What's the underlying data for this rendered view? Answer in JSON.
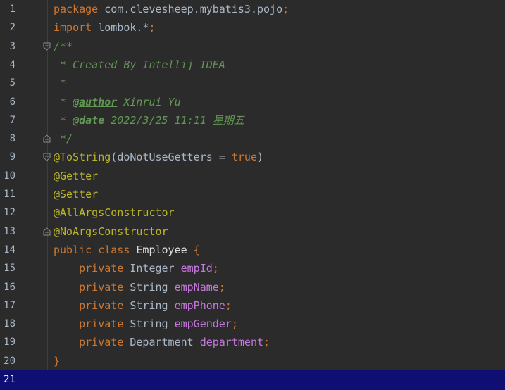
{
  "editor": {
    "current_line": 21,
    "lines": [
      {
        "n": "1",
        "tokens": [
          [
            "kw",
            "package"
          ],
          [
            "plain",
            " com.clevesheep.mybatis3.pojo"
          ],
          [
            "punct",
            ";"
          ]
        ]
      },
      {
        "n": "2",
        "tokens": [
          [
            "kw",
            "import"
          ],
          [
            "plain",
            " lombok.*"
          ],
          [
            "punct",
            ";"
          ]
        ]
      },
      {
        "n": "3",
        "tokens": [
          [
            "doc",
            "/**"
          ]
        ],
        "fold": "open"
      },
      {
        "n": "4",
        "tokens": [
          [
            "doc",
            " * Created By Intellij IDEA"
          ]
        ]
      },
      {
        "n": "5",
        "tokens": [
          [
            "doc",
            " *"
          ]
        ]
      },
      {
        "n": "6",
        "tokens": [
          [
            "doc",
            " * "
          ],
          [
            "doctag",
            "@author"
          ],
          [
            "doc",
            " Xinrui Yu"
          ]
        ]
      },
      {
        "n": "7",
        "tokens": [
          [
            "doc",
            " * "
          ],
          [
            "doctag",
            "@date"
          ],
          [
            "doc",
            " 2022/3/25 11:11 星期五"
          ]
        ]
      },
      {
        "n": "8",
        "tokens": [
          [
            "doc",
            " */"
          ]
        ],
        "fold": "close"
      },
      {
        "n": "9",
        "tokens": [
          [
            "ann",
            "@ToString"
          ],
          [
            "paren",
            "("
          ],
          [
            "plain",
            "doNotUseGetters = "
          ],
          [
            "kw",
            "true"
          ],
          [
            "paren",
            ")"
          ]
        ],
        "fold": "open"
      },
      {
        "n": "10",
        "tokens": [
          [
            "ann",
            "@Getter"
          ]
        ]
      },
      {
        "n": "11",
        "tokens": [
          [
            "ann",
            "@Setter"
          ]
        ]
      },
      {
        "n": "12",
        "tokens": [
          [
            "ann",
            "@AllArgsConstructor"
          ]
        ]
      },
      {
        "n": "13",
        "tokens": [
          [
            "ann",
            "@NoArgsConstructor"
          ]
        ],
        "fold": "close"
      },
      {
        "n": "14",
        "tokens": [
          [
            "kw",
            "public class "
          ],
          [
            "cls",
            "Employee"
          ],
          [
            "punct",
            " {"
          ]
        ]
      },
      {
        "n": "15",
        "tokens": [
          [
            "kw",
            "    private "
          ],
          [
            "plain",
            "Integer "
          ],
          [
            "field",
            "empId"
          ],
          [
            "punct",
            ";"
          ]
        ]
      },
      {
        "n": "16",
        "tokens": [
          [
            "kw",
            "    private "
          ],
          [
            "plain",
            "String "
          ],
          [
            "field",
            "empName"
          ],
          [
            "punct",
            ";"
          ]
        ]
      },
      {
        "n": "17",
        "tokens": [
          [
            "kw",
            "    private "
          ],
          [
            "plain",
            "String "
          ],
          [
            "field",
            "empPhone"
          ],
          [
            "punct",
            ";"
          ]
        ]
      },
      {
        "n": "18",
        "tokens": [
          [
            "kw",
            "    private "
          ],
          [
            "plain",
            "String "
          ],
          [
            "field",
            "empGender"
          ],
          [
            "punct",
            ";"
          ]
        ]
      },
      {
        "n": "19",
        "tokens": [
          [
            "kw",
            "    private "
          ],
          [
            "plain",
            "Department "
          ],
          [
            "field",
            "department"
          ],
          [
            "punct",
            ";"
          ]
        ]
      },
      {
        "n": "20",
        "tokens": [
          [
            "punct",
            "}"
          ]
        ]
      },
      {
        "n": "21",
        "tokens": []
      }
    ]
  },
  "colors": {
    "background": "#2b2b2b",
    "keyword": "#cc7832",
    "annotation": "#bbb529",
    "doc_comment": "#629755",
    "field": "#c678dd",
    "current_line": "#0f0f73"
  }
}
